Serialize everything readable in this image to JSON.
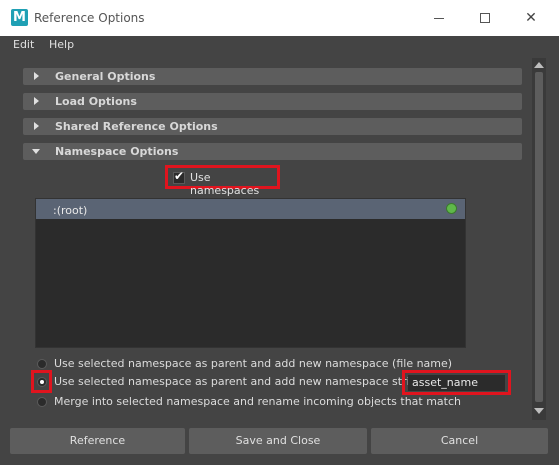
{
  "window": {
    "app_icon_letter": "M",
    "title": "Reference Options",
    "controls": {
      "minimize": "minimize",
      "maximize": "maximize",
      "close": "✕"
    }
  },
  "menu": {
    "edit": "Edit",
    "help": "Help"
  },
  "sections": {
    "general": "General Options",
    "load": "Load Options",
    "shared": "Shared Reference Options",
    "namespace": "Namespace Options"
  },
  "namespace": {
    "use_namespaces_label": "Use namespaces",
    "use_namespaces_checked": true,
    "tree_root": ":(root)",
    "radio_parent_file": "Use selected namespace as parent and add new namespace (file name)",
    "radio_parent_string": "Use selected namespace as parent and add new namespace string:",
    "radio_merge": "Merge into selected namespace and rename incoming objects that match",
    "selected_radio": "parent_string",
    "namespace_string_value": "asset_name"
  },
  "buttons": {
    "reference": "Reference",
    "save_close": "Save and Close",
    "cancel": "Cancel"
  },
  "colors": {
    "highlight": "#e0141e",
    "status_dot": "#5fb84a",
    "selected_row": "#5a6474"
  }
}
